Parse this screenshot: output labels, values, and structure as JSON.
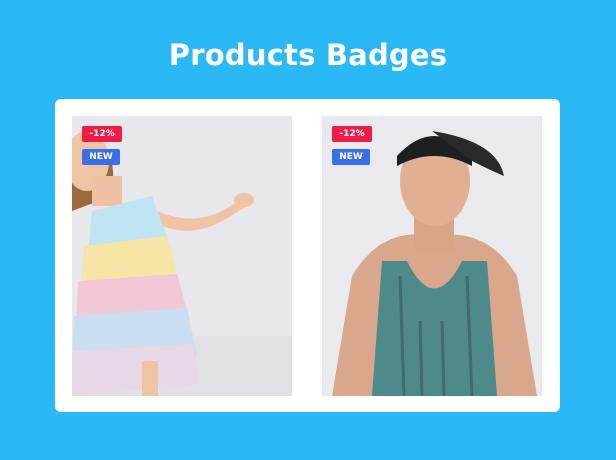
{
  "title": "Products Badges",
  "colors": {
    "background": "#2bb9f6",
    "sale_badge": "#f21a46",
    "new_badge": "#3b6fe6"
  },
  "products": [
    {
      "image": "woman-pastel-tulle-dress-photo",
      "badges": {
        "sale": "-12%",
        "new": "NEW"
      }
    },
    {
      "image": "man-teal-striped-tank-top-photo",
      "badges": {
        "sale": "-12%",
        "new": "NEW"
      }
    }
  ]
}
